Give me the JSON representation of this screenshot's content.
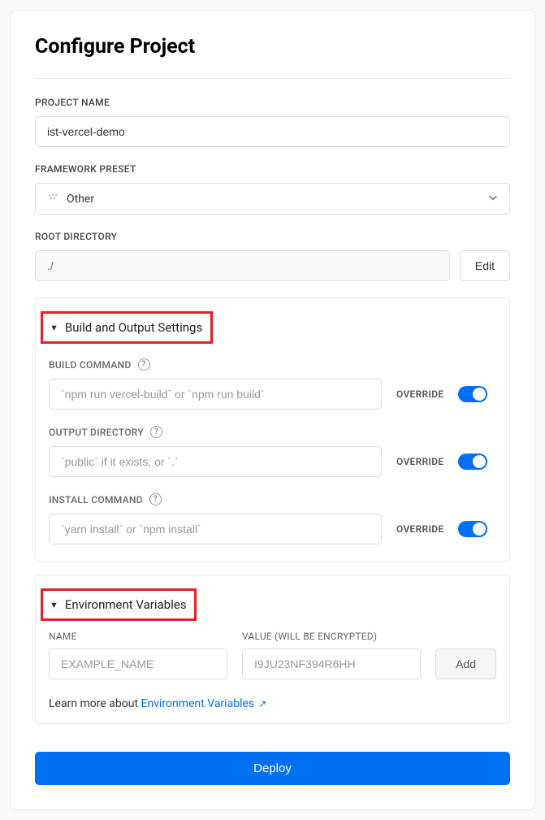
{
  "title": "Configure Project",
  "projectName": {
    "label": "PROJECT NAME",
    "value": "ist-vercel-demo"
  },
  "frameworkPreset": {
    "label": "FRAMEWORK PRESET",
    "selected": "Other"
  },
  "rootDirectory": {
    "label": "ROOT DIRECTORY",
    "value": "./",
    "editLabel": "Edit"
  },
  "buildSection": {
    "header": "Build and Output Settings",
    "buildCommand": {
      "label": "BUILD COMMAND",
      "placeholder": "`npm run vercel-build` or `npm run build`",
      "overrideLabel": "OVERRIDE"
    },
    "outputDirectory": {
      "label": "OUTPUT DIRECTORY",
      "placeholder": "`public` if it exists, or `.`",
      "overrideLabel": "OVERRIDE"
    },
    "installCommand": {
      "label": "INSTALL COMMAND",
      "placeholder": "`yarn install` or `npm install`",
      "overrideLabel": "OVERRIDE"
    }
  },
  "envSection": {
    "header": "Environment Variables",
    "nameLabel": "NAME",
    "namePlaceholder": "EXAMPLE_NAME",
    "valueLabel": "VALUE (WILL BE ENCRYPTED)",
    "valuePlaceholder": "I9JU23NF394R6HH",
    "addLabel": "Add",
    "learnMorePrefix": "Learn more about ",
    "learnMoreLink": "Environment Variables"
  },
  "deployLabel": "Deploy"
}
